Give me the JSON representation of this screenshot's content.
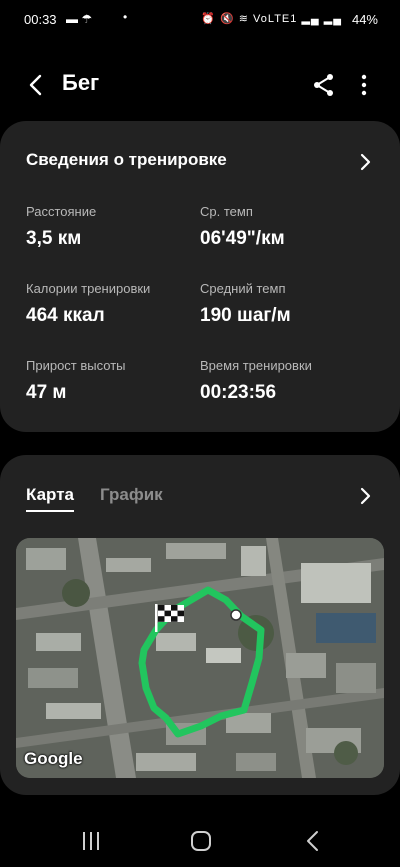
{
  "status_bar": {
    "time": "00:33",
    "left_icons": "▬ ☂",
    "dot": "•",
    "right_icons": "⏰ 🔇 ≋ VoLTE1 ▂▄ ▂▄",
    "battery": "44%"
  },
  "header": {
    "title": "Бег"
  },
  "workout": {
    "section_title": "Сведения о тренировке",
    "stats": [
      {
        "label": "Расстояние",
        "value": "3,5 км"
      },
      {
        "label": "Ср. темп",
        "value": "06'49\"/км"
      },
      {
        "label": "Калории тренировки",
        "value": "464 ккал"
      },
      {
        "label": "Средний темп",
        "value": "190 шаг/м"
      },
      {
        "label": "Прирост высоты",
        "value": "47 м"
      },
      {
        "label": "Время тренировки",
        "value": "00:23:56"
      }
    ]
  },
  "map_section": {
    "tabs": [
      {
        "label": "Карта",
        "active": true
      },
      {
        "label": "График",
        "active": false
      }
    ],
    "map_attribution": "Google",
    "route_color": "#22c55e"
  }
}
